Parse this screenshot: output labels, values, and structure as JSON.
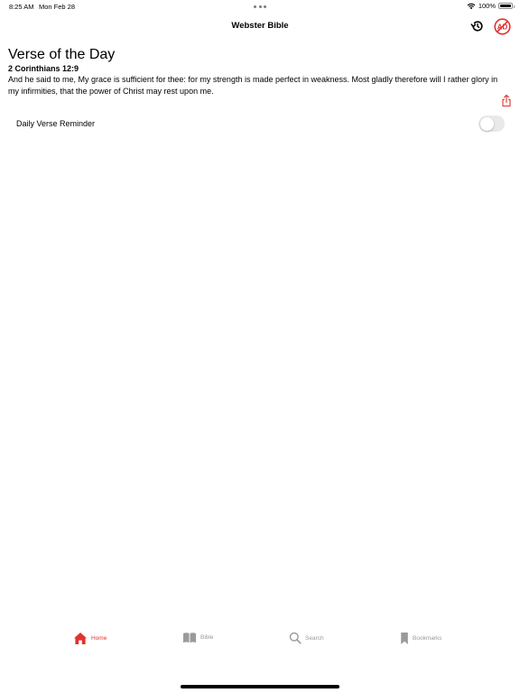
{
  "status_bar": {
    "time": "8:25 AM",
    "date": "Mon Feb 28",
    "battery": "100%"
  },
  "nav": {
    "title": "Webster Bible",
    "history_icon": "history-icon",
    "no_ads_icon": "no-ads-icon"
  },
  "verse_of_day": {
    "heading": "Verse of the Day",
    "reference": "2 Corinthians 12:9",
    "text": "And he said to me, My grace is sufficient for thee: for my strength is made perfect in weakness. Most gladly therefore will I rather glory in my infirmities, that the power of Christ may rest upon me.",
    "share_icon": "share-icon"
  },
  "reminder": {
    "label": "Daily Verse Reminder",
    "enabled": false
  },
  "tabs": [
    {
      "label": "Home",
      "icon": "home-icon",
      "active": true
    },
    {
      "label": "Bible",
      "icon": "book-icon",
      "active": false
    },
    {
      "label": "Search",
      "icon": "search-icon",
      "active": false
    },
    {
      "label": "Bookmarks",
      "icon": "bookmark-icon",
      "active": false
    }
  ],
  "colors": {
    "accent": "#e0332f",
    "inactive": "#9a9a9a",
    "toggle_off": "#e9e9eb"
  }
}
